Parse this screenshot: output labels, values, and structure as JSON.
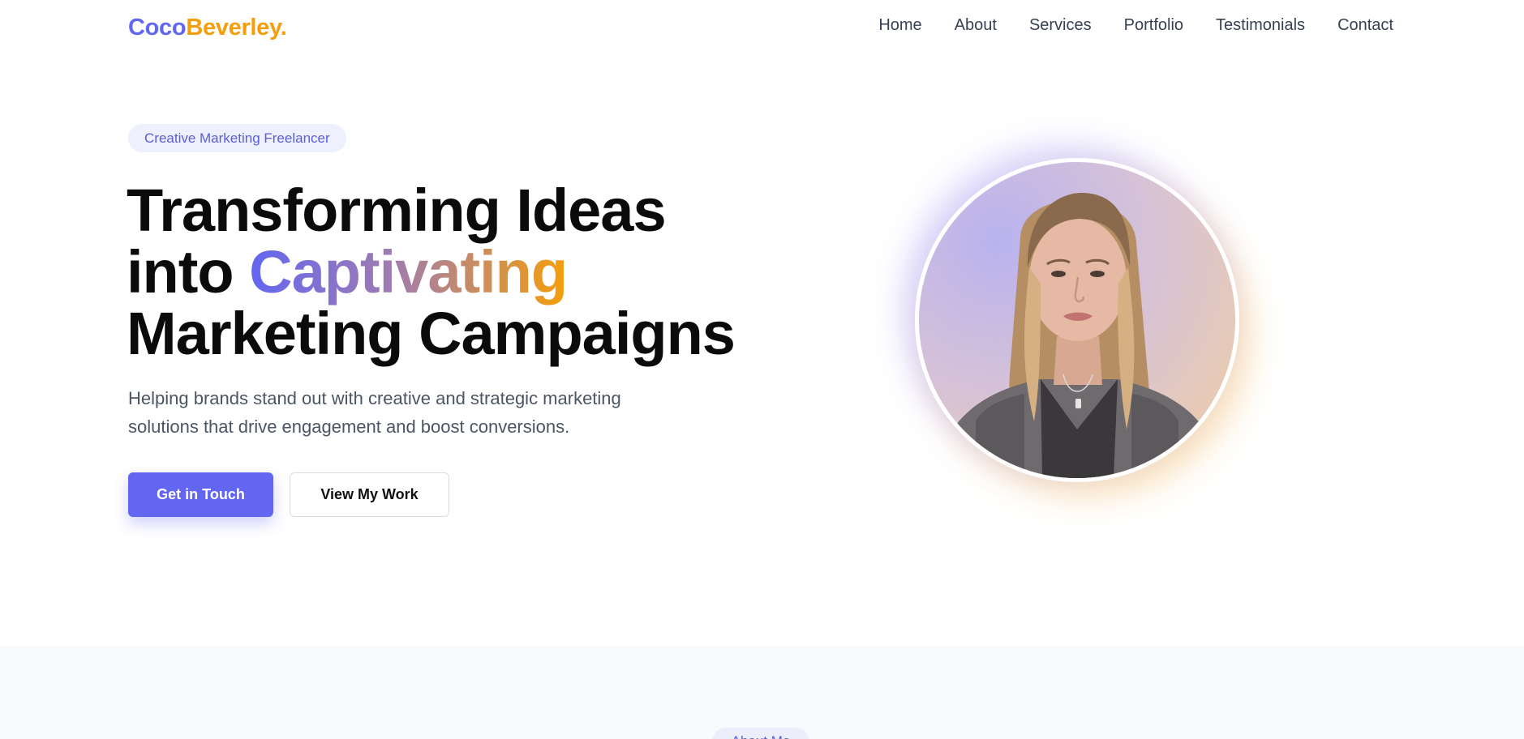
{
  "logo": {
    "part1": "Coco",
    "part2": "Beverley."
  },
  "nav": {
    "items": [
      "Home",
      "About",
      "Services",
      "Portfolio",
      "Testimonials",
      "Contact"
    ]
  },
  "hero": {
    "badge": "Creative Marketing Freelancer",
    "headline_line1": "Transforming Ideas",
    "headline_line2_prefix": "into ",
    "headline_highlight": "Captivating",
    "headline_line3": "Marketing Campaigns",
    "subtitle": "Helping brands stand out with creative and strategic marketing solutions that drive engagement and boost conversions.",
    "primary_button": "Get in Touch",
    "secondary_button": "View My Work"
  },
  "about": {
    "badge": "About Me"
  },
  "colors": {
    "accent": "#6366f1",
    "brand_secondary": "#f59e0b",
    "text": "#111111",
    "muted": "#4b5563"
  }
}
